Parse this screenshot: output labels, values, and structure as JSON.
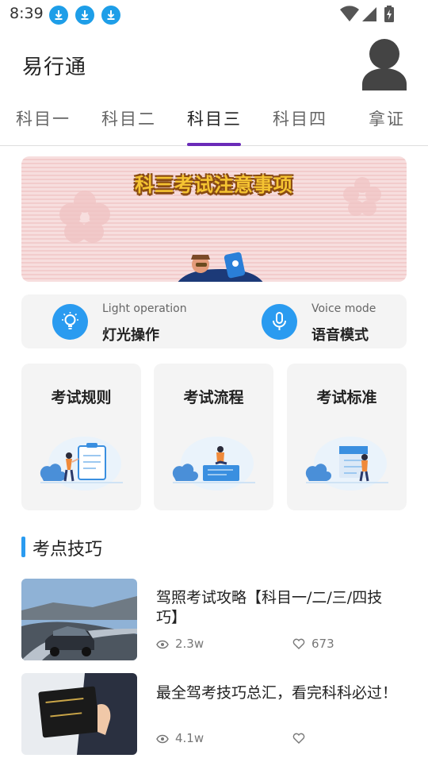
{
  "status_bar": {
    "time": "8:39"
  },
  "header": {
    "title": "易行通"
  },
  "tabs": [
    {
      "label": "科目一",
      "active": false
    },
    {
      "label": "科目二",
      "active": false
    },
    {
      "label": "科目三",
      "active": true
    },
    {
      "label": "科目四",
      "active": false
    },
    {
      "label": "拿证",
      "active": false
    }
  ],
  "banner": {
    "title": "科三考试注意事项"
  },
  "modes": [
    {
      "en": "Light operation",
      "zh": "灯光操作",
      "icon": "lightbulb-icon"
    },
    {
      "en": "Voice mode",
      "zh": "语音模式",
      "icon": "microphone-icon"
    }
  ],
  "exam_cards": [
    {
      "title": "考试规则"
    },
    {
      "title": "考试流程"
    },
    {
      "title": "考试标准"
    }
  ],
  "section": {
    "title": "考点技巧"
  },
  "articles": [
    {
      "title": "驾照考试攻略【科目一/二/三/四技巧】",
      "views": "2.3w",
      "likes": "673"
    },
    {
      "title": "最全驾考技巧总汇，看完科科必过！",
      "views": "4.1w",
      "likes": ""
    }
  ],
  "colors": {
    "accent": "#2a9bf0",
    "tab_indicator": "#6a2bb8",
    "card_bg": "#f4f4f4"
  }
}
